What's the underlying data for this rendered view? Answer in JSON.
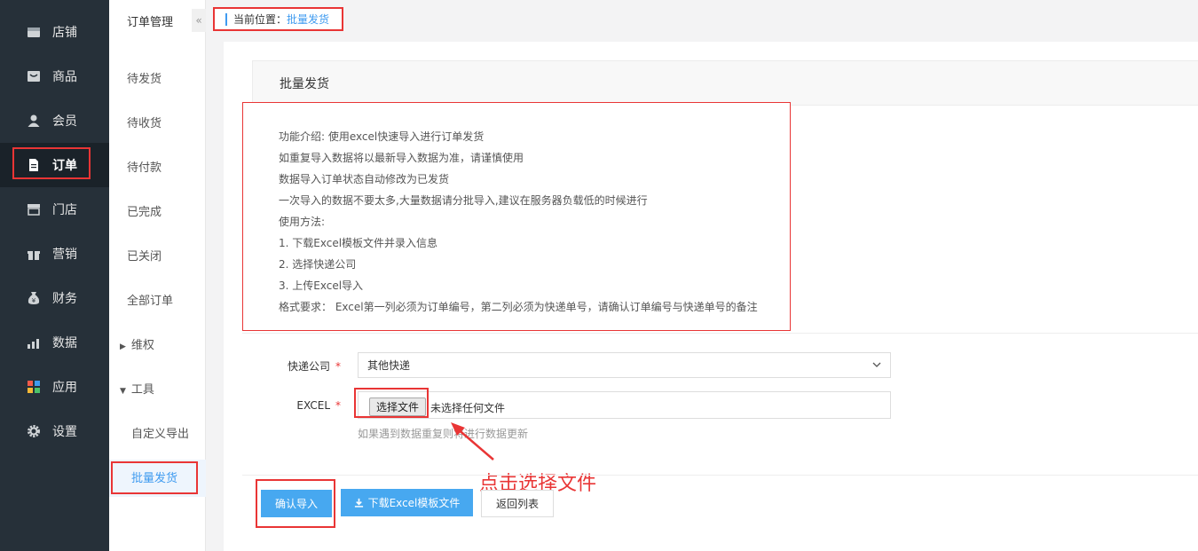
{
  "nav": {
    "items": [
      {
        "label": "店铺",
        "icon": "store-icon"
      },
      {
        "label": "商品",
        "icon": "product-icon"
      },
      {
        "label": "会员",
        "icon": "user-icon"
      },
      {
        "label": "订单",
        "icon": "order-document-icon"
      },
      {
        "label": "门店",
        "icon": "shop-icon"
      },
      {
        "label": "营销",
        "icon": "gift-icon"
      },
      {
        "label": "财务",
        "icon": "money-bag-icon"
      },
      {
        "label": "数据",
        "icon": "bar-chart-icon"
      },
      {
        "label": "应用",
        "icon": "apps-grid-icon"
      },
      {
        "label": "设置",
        "icon": "gear-icon"
      }
    ],
    "active_index": 3
  },
  "subnav": {
    "title": "订单管理",
    "collapse_glyph": "«",
    "items": [
      "待发货",
      "待收货",
      "待付款",
      "已完成",
      "已关闭",
      "全部订单"
    ],
    "groups": [
      {
        "label": "维权",
        "expanded": false
      },
      {
        "label": "工具",
        "expanded": true
      }
    ],
    "tool_children": [
      "自定义导出",
      "批量发货"
    ],
    "active": "批量发货"
  },
  "breadcrumb": {
    "prefix": "当前位置：",
    "current": "批量发货"
  },
  "panel": {
    "title": "批量发货"
  },
  "intro": {
    "lines": [
      "功能介绍: 使用excel快速导入进行订单发货",
      "如重复导入数据将以最新导入数据为准，请谨慎使用",
      "数据导入订单状态自动修改为已发货",
      "一次导入的数据不要太多,大量数据请分批导入,建议在服务器负载低的时候进行",
      "使用方法:",
      "1. 下载Excel模板文件并录入信息",
      "2. 选择快递公司",
      "3. 上传Excel导入",
      "格式要求： Excel第一列必须为订单编号，第二列必须为快递单号，请确认订单编号与快递单号的备注"
    ]
  },
  "form": {
    "express_label": "快递公司",
    "express_value": "其他快递",
    "excel_label": "EXCEL",
    "required_mark": "*",
    "file_button": "选择文件",
    "file_status": "未选择任何文件",
    "hint": "如果遇到数据重复则将进行数据更新"
  },
  "annotation": {
    "text": "点击选择文件",
    "color": "#e93535"
  },
  "buttons": {
    "confirm": "确认导入",
    "download": "下载Excel模板文件",
    "back": "返回列表"
  },
  "colors": {
    "accent": "#47a8f0",
    "highlight": "#e93535",
    "nav_bg": "#263039"
  }
}
